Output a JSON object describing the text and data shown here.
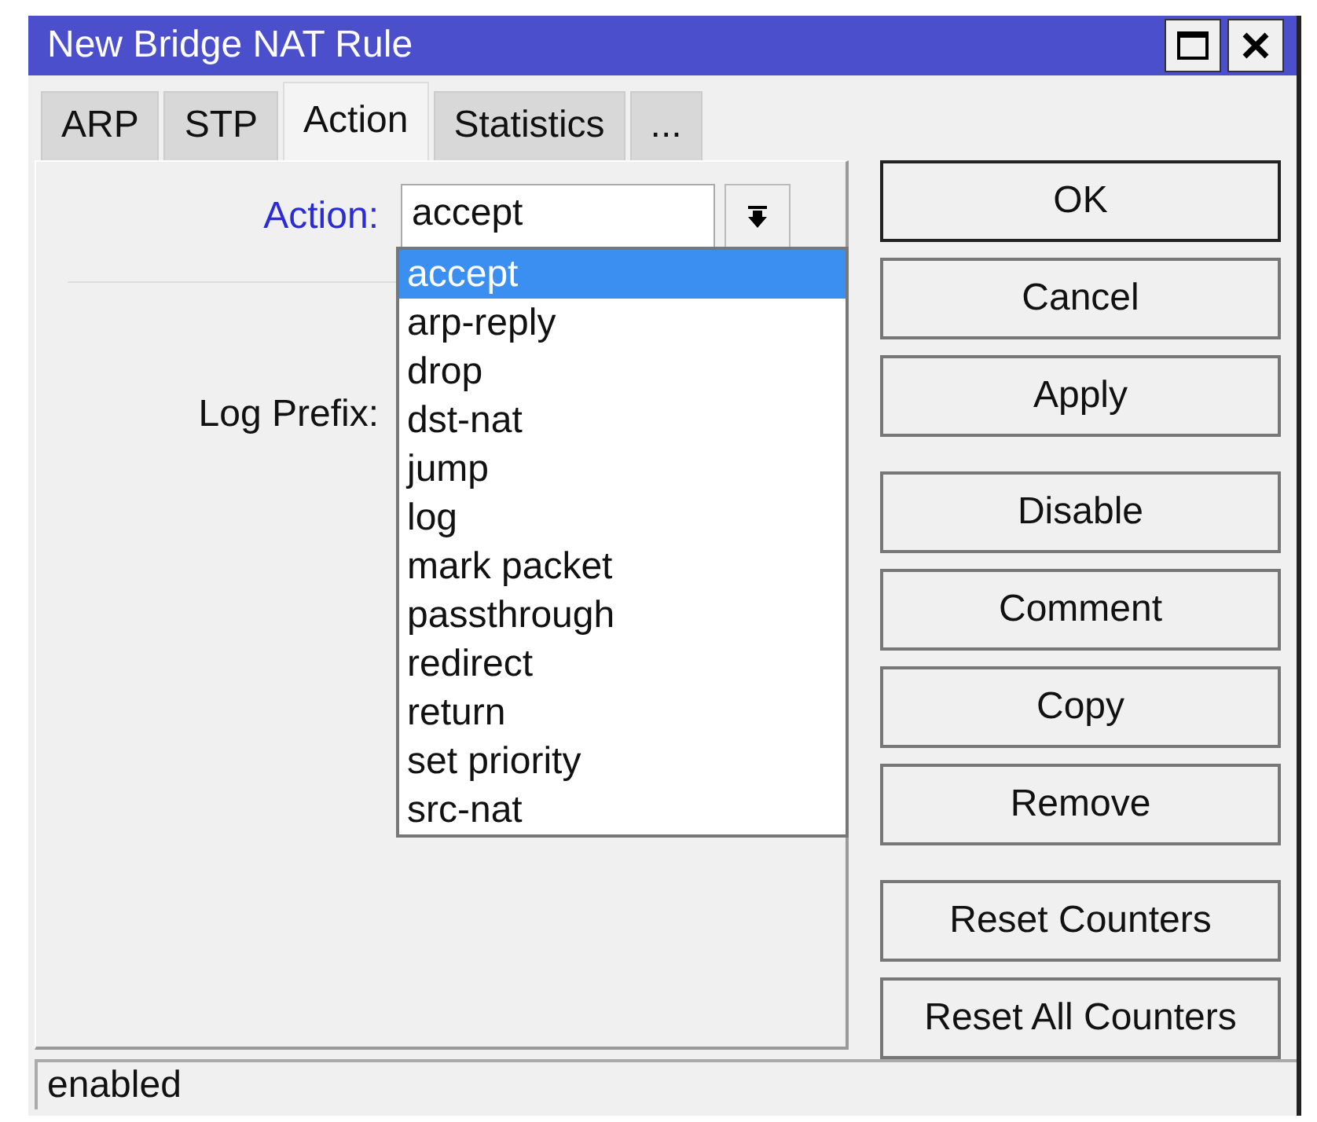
{
  "window": {
    "title": "New Bridge NAT Rule"
  },
  "tabs": [
    {
      "label": "ARP",
      "selected": false
    },
    {
      "label": "STP",
      "selected": false
    },
    {
      "label": "Action",
      "selected": true
    },
    {
      "label": "Statistics",
      "selected": false
    },
    {
      "label": "...",
      "selected": false
    }
  ],
  "action_field": {
    "label": "Action:",
    "value": "accept",
    "options": [
      {
        "label": "accept",
        "selected": true
      },
      {
        "label": "arp-reply",
        "selected": false
      },
      {
        "label": "drop",
        "selected": false
      },
      {
        "label": "dst-nat",
        "selected": false
      },
      {
        "label": "jump",
        "selected": false
      },
      {
        "label": "log",
        "selected": false
      },
      {
        "label": "mark packet",
        "selected": false
      },
      {
        "label": "passthrough",
        "selected": false
      },
      {
        "label": "redirect",
        "selected": false
      },
      {
        "label": "return",
        "selected": false
      },
      {
        "label": "set priority",
        "selected": false
      },
      {
        "label": "src-nat",
        "selected": false
      }
    ]
  },
  "log_prefix": {
    "label": "Log Prefix:"
  },
  "button_groups": [
    [
      {
        "label": "OK",
        "default": true
      },
      {
        "label": "Cancel",
        "default": false
      },
      {
        "label": "Apply",
        "default": false
      }
    ],
    [
      {
        "label": "Disable",
        "default": false
      },
      {
        "label": "Comment",
        "default": false
      },
      {
        "label": "Copy",
        "default": false
      },
      {
        "label": "Remove",
        "default": false
      }
    ],
    [
      {
        "label": "Reset Counters",
        "default": false
      },
      {
        "label": "Reset All Counters",
        "default": false
      }
    ]
  ],
  "status_bar": "enabled"
}
